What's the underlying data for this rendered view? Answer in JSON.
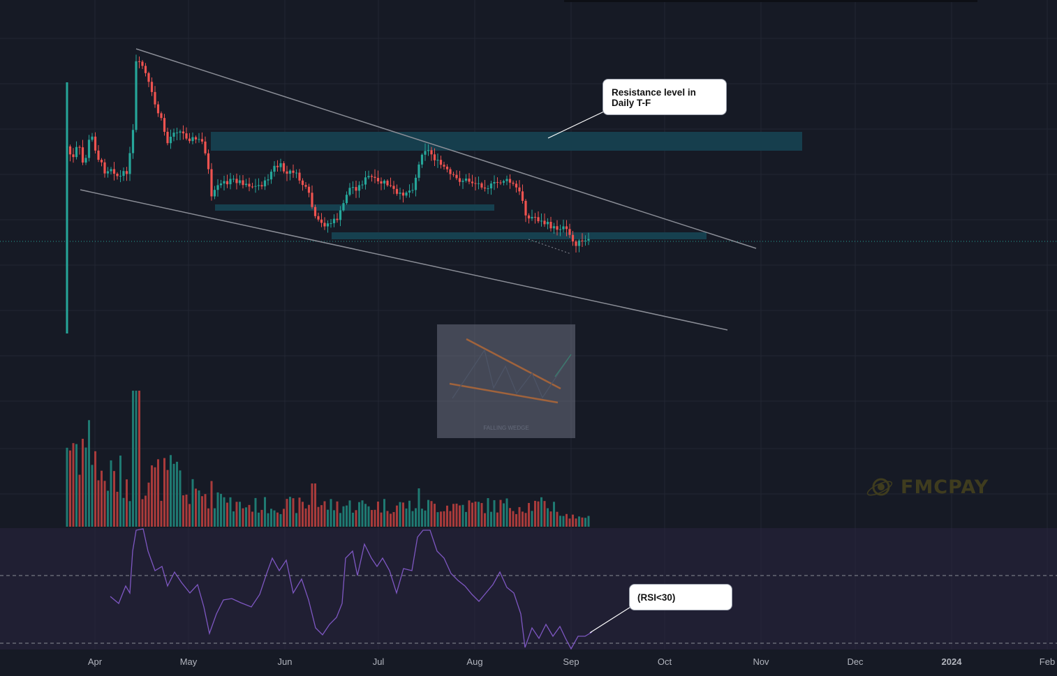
{
  "chart_data": {
    "type": "candlestick",
    "x_axis_labels": [
      "Apr",
      "May",
      "Jun",
      "Jul",
      "Aug",
      "Sep",
      "Oct",
      "Nov",
      "Dec",
      "2024",
      "Feb"
    ],
    "annotations": {
      "resistance_callout": "Resistance level in\nDaily T-F",
      "rsi_callout": "(RSI<30)",
      "pattern_thumbnail_caption": "FALLING WEDGE"
    },
    "patterns": [
      "falling wedge"
    ],
    "panes": [
      "price",
      "volume",
      "RSI"
    ],
    "rsi_lines": [
      70,
      30
    ],
    "colors": {
      "background": "#161a25",
      "bull": "#26a69a",
      "bear": "#ef5350",
      "rsi_line": "#7e57c2",
      "zone": "#16404f",
      "wedge_lines": "#8a8d96"
    }
  },
  "watermark": {
    "text": "FMCPAY",
    "icon": "planet-logo-icon"
  }
}
